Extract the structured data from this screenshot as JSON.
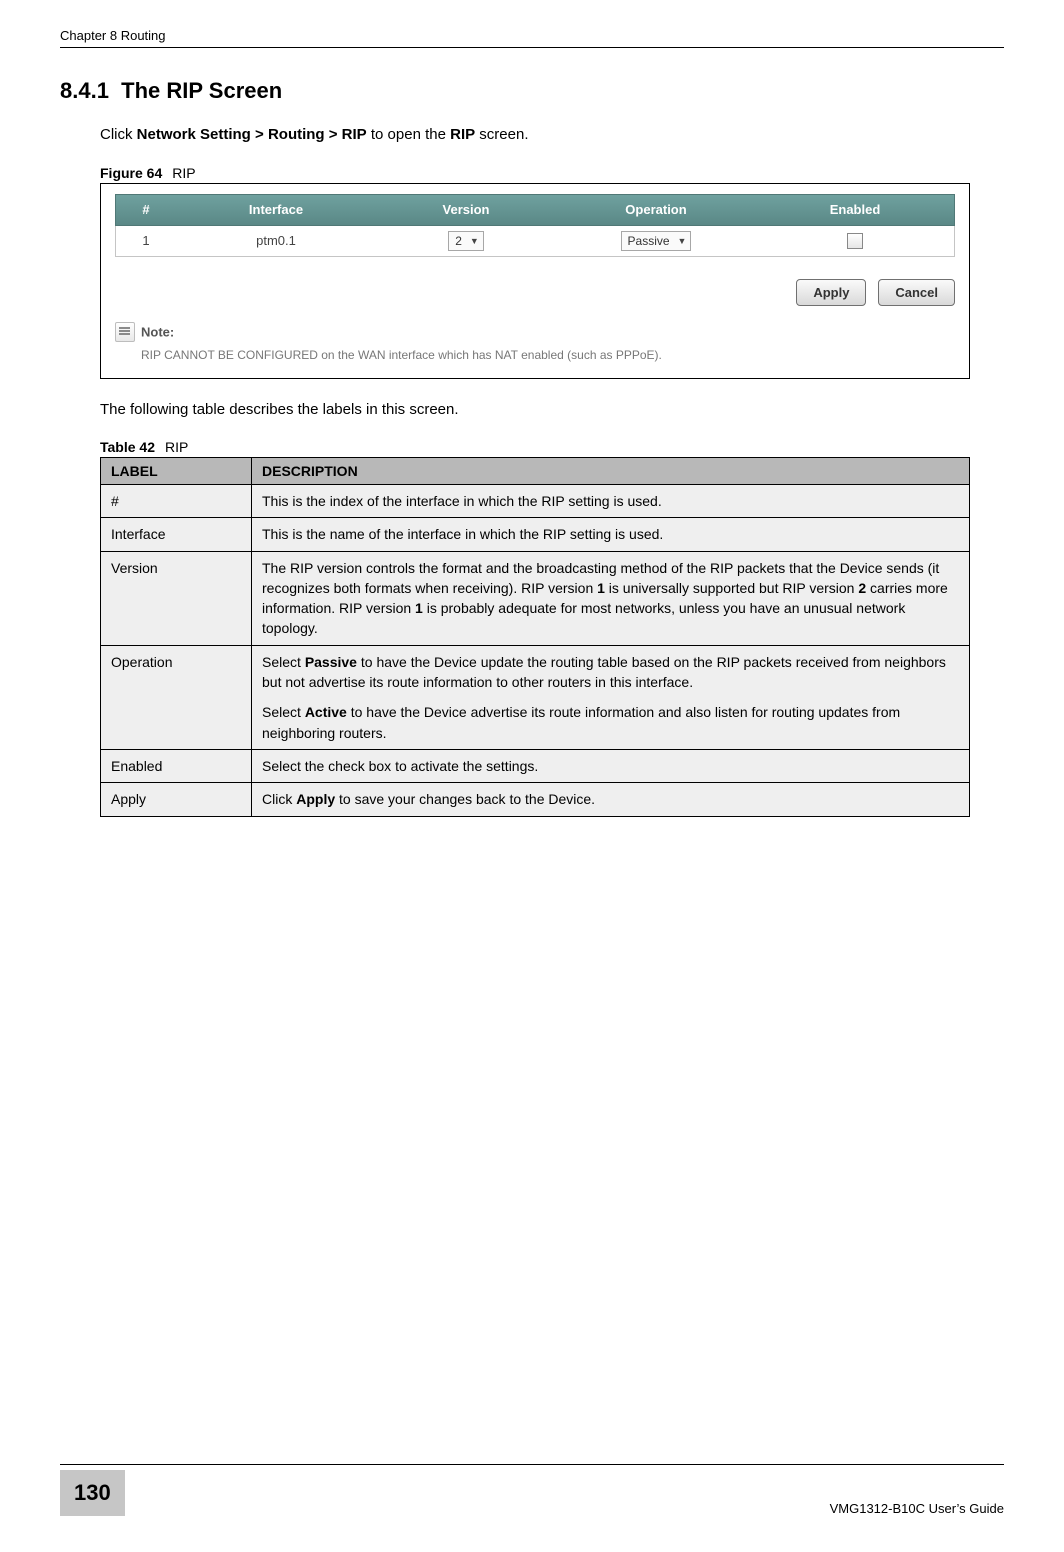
{
  "header": {
    "chapter": "Chapter 8 Routing"
  },
  "section": {
    "number": "8.4.1",
    "title": "The RIP Screen",
    "intro_prefix": "Click ",
    "intro_bold1": "Network Setting > Routing >  RIP",
    "intro_mid": " to open the ",
    "intro_bold2": "RIP",
    "intro_suffix": " screen."
  },
  "figure": {
    "label": "Figure 64",
    "title": "RIP",
    "columns": {
      "hash": "#",
      "interface": "Interface",
      "version": "Version",
      "operation": "Operation",
      "enabled": "Enabled"
    },
    "row": {
      "index": "1",
      "interface": "ptm0.1",
      "version": "2",
      "operation": "Passive"
    },
    "buttons": {
      "apply": "Apply",
      "cancel": "Cancel"
    },
    "note_label": "Note:",
    "note_text": "RIP CANNOT BE CONFIGURED on the WAN interface which has NAT enabled (such as PPPoE)."
  },
  "post_figure": "The following table describes the labels in this screen.",
  "table": {
    "label": "Table 42",
    "title": "RIP",
    "head_label": "LABEL",
    "head_desc": "DESCRIPTION",
    "rows": [
      {
        "label": "#",
        "desc": "This is the index of the interface in which the RIP setting is used."
      },
      {
        "label": "Interface",
        "desc": "This is the name of the interface in which the RIP setting is used."
      },
      {
        "label": "Version",
        "desc_p1a": "The RIP version controls the format and the broadcasting method of the RIP packets that the Device sends (it recognizes both formats when receiving). RIP version ",
        "desc_b1": "1",
        "desc_p1b": " is universally supported but RIP version ",
        "desc_b2": "2",
        "desc_p1c": " carries more information. RIP version ",
        "desc_b3": "1",
        "desc_p1d": " is probably adequate for most networks, unless you have an unusual network topology."
      },
      {
        "label": "Operation",
        "op_p1a": "Select ",
        "op_b1": "Passive",
        "op_p1b": " to have the Device update the routing table based on the RIP packets received from neighbors but not advertise its route information to other routers in this interface.",
        "op_p2a": "Select ",
        "op_b2": "Active",
        "op_p2b": " to have the Device advertise its route information and also listen for routing updates from neighboring routers."
      },
      {
        "label": "Enabled",
        "desc": "Select the check box to activate the settings."
      },
      {
        "label": "Apply",
        "ap_a": "Click ",
        "ap_b": "Apply",
        "ap_c": " to save your changes back to the Device."
      }
    ]
  },
  "footer": {
    "page": "130",
    "guide": "VMG1312-B10C User’s Guide"
  }
}
